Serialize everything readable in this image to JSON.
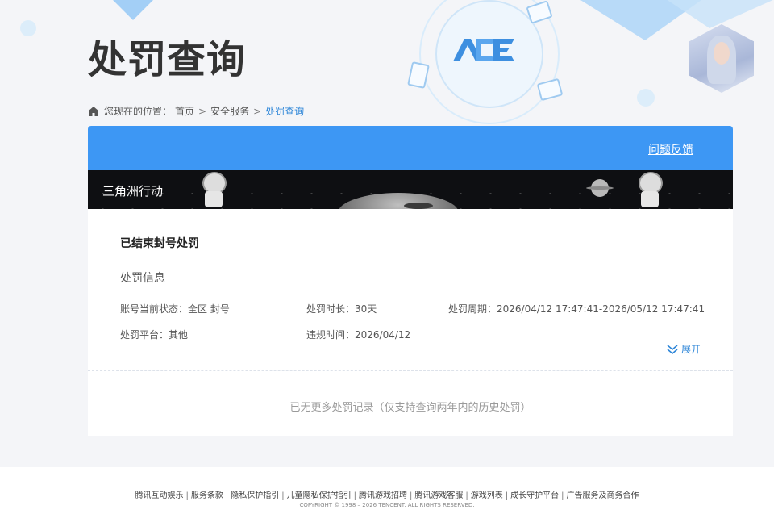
{
  "header": {
    "title": "处罚查询",
    "logo_text": "ACE"
  },
  "breadcrumb": {
    "prefix": "您现在的位置：",
    "items": [
      "首页",
      "安全服务",
      "处罚查询"
    ],
    "separator": ">"
  },
  "panel": {
    "feedback_label": "问题反馈",
    "game_name": "三角洲行动",
    "ended_title": "已结束封号处罚",
    "info_title": "处罚信息",
    "fields": {
      "account_status": "账号当前状态：全区 封号",
      "duration": "处罚时长：30天",
      "period": "处罚周期：2026/04/12 17:47:41-2026/05/12 17:47:41",
      "platform": "处罚平台：其他",
      "violation_time": "违规时间：2026/04/12"
    },
    "expand_label": "展开",
    "no_more_text": "已无更多处罚记录（仅支持查询两年内的历史处罚）"
  },
  "footer": {
    "links": [
      "腾讯互动娱乐",
      "服务条款",
      "隐私保护指引",
      "儿童隐私保护指引",
      "腾讯游戏招聘",
      "腾讯游戏客服",
      "游戏列表",
      "成长守护平台",
      "广告服务及商务合作"
    ],
    "separator": "|",
    "copyright": "COPYRIGHT © 1998 – 2026 TENCENT. ALL RIGHTS RESERVED."
  },
  "colors": {
    "accent": "#3d97f4",
    "link": "#2e86d8",
    "banner_bg": "#0e0f12"
  }
}
